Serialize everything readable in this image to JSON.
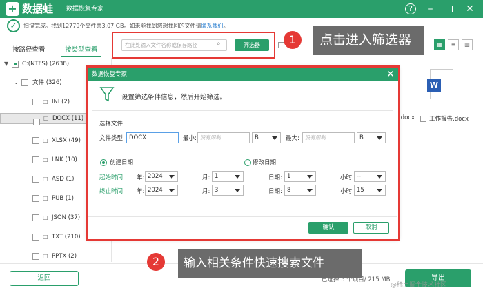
{
  "app": {
    "name": "数据蛙",
    "subtitle": "数据恢复专家"
  },
  "window": {
    "help": "?",
    "minimize": "–",
    "close": "✕"
  },
  "status": {
    "text": "扫描完成。找到12779个文件共3.07 GB。如未能找到您想找回的文件请",
    "link": "联系我们",
    "tail": "。"
  },
  "tabs": {
    "path": "按路径查看",
    "type": "按类型查看"
  },
  "tree": [
    {
      "label": "C:(NTFS) (2638)"
    },
    {
      "label": "文件 (326)"
    },
    {
      "label": "INI (2)"
    },
    {
      "label": "DOCX (11)"
    },
    {
      "label": "XLSX (49)"
    },
    {
      "label": "LNK (10)"
    },
    {
      "label": "ASD (1)"
    },
    {
      "label": "PUB (1)"
    },
    {
      "label": "JSON (37)"
    },
    {
      "label": "TXT (210)"
    },
    {
      "label": "PPTX (2)"
    }
  ],
  "search": {
    "placeholder": "在此处输入文件名称或保存路径",
    "filter_button": "筛选器"
  },
  "callouts": {
    "one_num": "1",
    "one_text": "点击进入筛选器",
    "two_num": "2",
    "two_text": "输入相关条件快速搜索文件"
  },
  "files": {
    "card_name": "工作报告.docx",
    "partial_right": ".docx"
  },
  "dialog": {
    "title": "数据恢复专家",
    "hint": "设置筛选条件信息，然后开始筛选。",
    "section_file": "选择文件",
    "file_type_label": "文件类型:",
    "file_type_value": "DOCX",
    "min_label": "最小:",
    "min_placeholder": "没有限制",
    "min_unit": "B",
    "max_label": "最大:",
    "max_placeholder": "没有限制",
    "max_unit": "B",
    "created_date": "创建日期",
    "modified_date": "修改日期",
    "start_label": "起始时间:",
    "end_label": "终止时间:",
    "year_label": "年:",
    "month_label": "月:",
    "day_label": "日期:",
    "hour_label": "小时:",
    "start": {
      "year": "2024",
      "month": "1",
      "day": "1",
      "hour": "--"
    },
    "end": {
      "year": "2024",
      "month": "3",
      "day": "8",
      "hour": "15"
    },
    "ok": "确认",
    "cancel": "取消"
  },
  "bottom": {
    "back": "返回",
    "selected": "已选择 5 个项目/ 215 MB",
    "export": "导出",
    "watermark": "@稀土掘金技术社区"
  },
  "colors": {
    "accent": "#2a9f6b",
    "highlight": "#e53935",
    "callout_bg": "#6b6b6b"
  }
}
